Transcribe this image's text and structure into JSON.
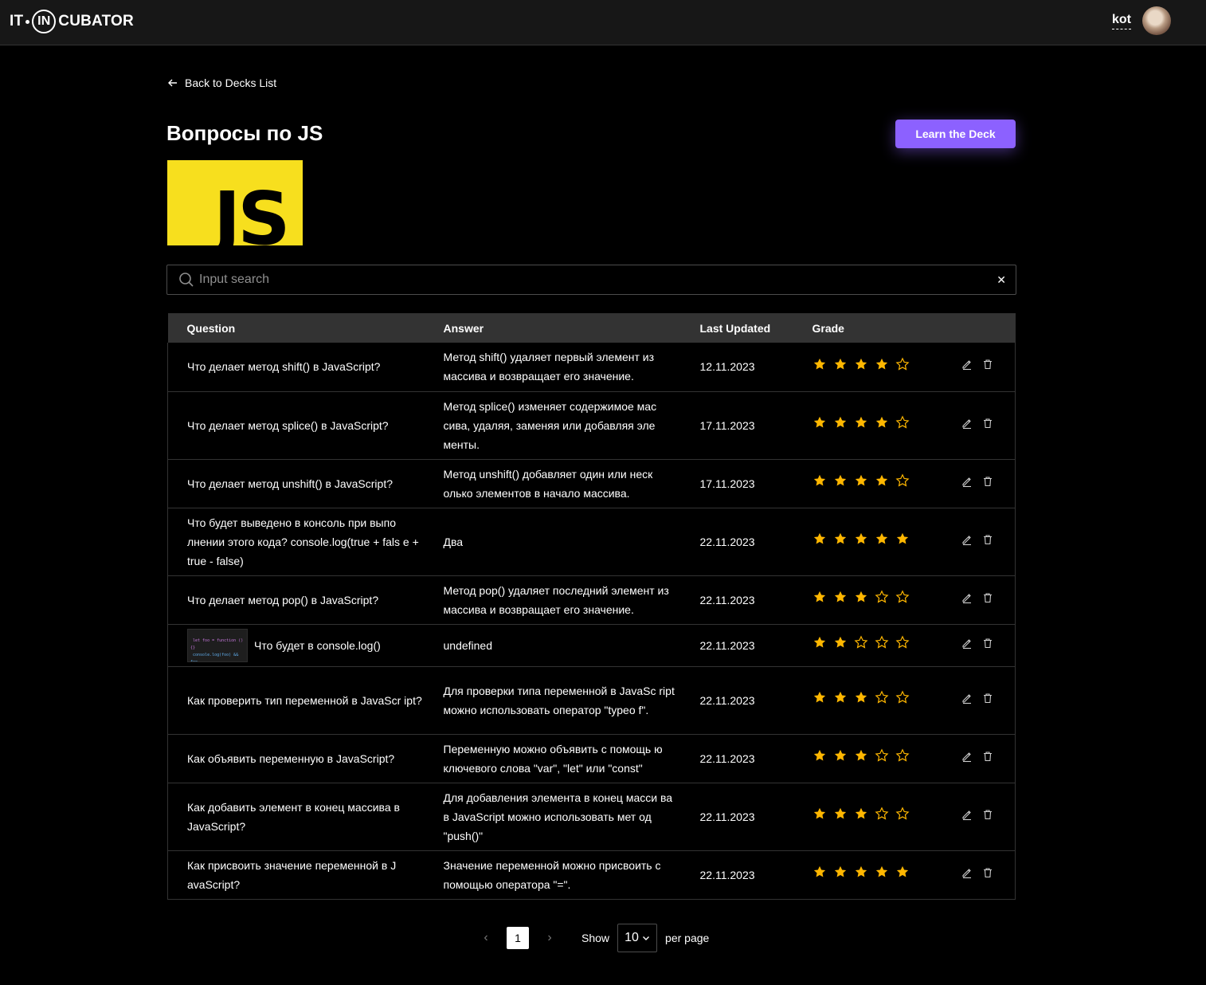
{
  "header": {
    "logo_left": "IT",
    "logo_mid": "IN",
    "logo_right": "CUBATOR",
    "user_name": "kot"
  },
  "back_link": "Back to Decks List",
  "deck": {
    "title": "Вопросы по JS",
    "learn_label": "Learn the Deck",
    "cover_text": "JS"
  },
  "search": {
    "placeholder": "Input search",
    "value": ""
  },
  "columns": {
    "question": "Question",
    "answer": "Answer",
    "updated": "Last Updated",
    "grade": "Grade"
  },
  "rows": [
    {
      "question": "Что делает метод shift() в JavaScript?",
      "answer": "Метод shift() удаляет первый элемент из массива и возвращает его значение.",
      "updated": "12.11.2023",
      "grade": 4
    },
    {
      "question": "Что делает метод splice() в JavaScript?",
      "answer": "Метод splice() изменяет содержимое мас сива, удаляя, заменяя или добавляя эле менты.",
      "updated": "17.11.2023",
      "grade": 4
    },
    {
      "question": "Что делает метод unshift() в JavaScript?",
      "answer": "Метод unshift() добавляет один или неск олько элементов в начало массива.",
      "updated": "17.11.2023",
      "grade": 4
    },
    {
      "question": "Что будет выведено в консоль при выпо лнении этого кода? console.log(true + fals e + true - false)",
      "answer": "Два",
      "updated": "22.11.2023",
      "grade": 5
    },
    {
      "question": "Что делает метод pop() в JavaScript?",
      "answer": "Метод pop() удаляет последний элемент из массива и возвращает его значение.",
      "updated": "22.11.2023",
      "grade": 3
    },
    {
      "question": "Что будет в console.log()",
      "answer": "undefined",
      "updated": "22.11.2023",
      "grade": 2,
      "has_image": true
    },
    {
      "question": "Как проверить тип переменной в JavaScr ipt?",
      "answer": "Для проверки типа переменной в JavaSc ript можно использовать оператор \"typeo f\".",
      "updated": "22.11.2023",
      "grade": 3
    },
    {
      "question": "Как объявить переменную в JavaScript?",
      "answer": "Переменную можно объявить с помощь ю ключевого слова \"var\", \"let\" или \"const\"",
      "updated": "22.11.2023",
      "grade": 3
    },
    {
      "question": "Как добавить элемент в конец массива в JavaScript?",
      "answer": "Для добавления элемента в конец масси ва в JavaScript можно использовать мет од \"push()\"",
      "updated": "22.11.2023",
      "grade": 3
    },
    {
      "question": "Как присвоить значение переменной в J avaScript?",
      "answer": "Значение переменной можно присвоить с помощью оператора \"=\".",
      "updated": "22.11.2023",
      "grade": 5
    }
  ],
  "pagination": {
    "current_page": "1",
    "show_label": "Show",
    "per_page": "10",
    "per_page_label": "per page"
  },
  "colors": {
    "accent": "#8c61ff",
    "star": "#ffb700",
    "header_bg": "#333333"
  }
}
